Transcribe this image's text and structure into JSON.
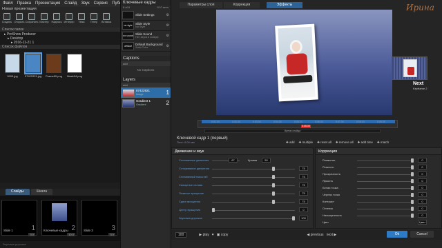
{
  "menubar": {
    "items": [
      "Файл",
      "Правка",
      "Презентация",
      "Слайд",
      "Звук",
      "Сервис",
      "Публикация",
      "Вид"
    ],
    "right": [
      "⌂",
      "?",
      "–",
      "□",
      "×"
    ]
  },
  "project": {
    "title": "Новая презентация"
  },
  "toolbar": {
    "buttons": [
      "Создать",
      "Открыть",
      "Сохранить",
      "Мастер",
      "Надпись",
      "Интерпр",
      "Тема",
      "Генер",
      "Вставка"
    ]
  },
  "folders": {
    "header": "Список папок",
    "tree": [
      "ProShow Producer",
      "Desktop",
      "2016-11-21 1"
    ]
  },
  "files": {
    "header": "Список файлов",
    "items": [
      {
        "name": "9909.jpg",
        "color": "#c7d8e8"
      },
      {
        "name": "07422921.jpg",
        "color": "#4a86c4"
      },
      {
        "name": "Frame89.png",
        "color": "#6b3b1b"
      },
      {
        "name": "Mask94.png",
        "color": "#ffffff"
      }
    ]
  },
  "bottom_tabs": [
    "Слайды",
    "Шкала"
  ],
  "slides": [
    {
      "label": "Slide 1",
      "num": "1",
      "time": "3.0"
    },
    {
      "label": "Ключевые кадры",
      "num": "2",
      "time": "10.0"
    },
    {
      "label": "Slide 3",
      "num": "3",
      "time": "3.0"
    }
  ],
  "status_text": "Звуковая дорожка",
  "keyframes": {
    "title": "Ключевые кадры",
    "sub": "8 of 8",
    "time": "10.0 secs",
    "items": [
      {
        "icon": "",
        "title": "Slide Settings",
        "sub": ""
      },
      {
        "icon": "no style",
        "title": "Slide Style",
        "sub": "No Style"
      },
      {
        "icon": "no sound",
        "title": "Slide Sound",
        "sub": "Нет звука в слайде"
      },
      {
        "icon": "default",
        "title": "Default Background",
        "sub": "Solid Color"
      }
    ]
  },
  "captions": {
    "title": "Captions",
    "add": "add",
    "empty": "No Captions"
  },
  "layers": {
    "title": "Layers",
    "add": "add",
    "items": [
      {
        "name": "07422921",
        "sub": "Image",
        "num": "1",
        "selected": true
      },
      {
        "name": "Gradient 1",
        "sub": "Gradient",
        "num": "2",
        "selected": false
      }
    ]
  },
  "main_tabs": [
    "Параметры слоя",
    "Коррекция",
    "Эффекты"
  ],
  "active_tab": 2,
  "watermark": "Ирина",
  "next": {
    "label": "Next",
    "sub": "Keyframe 2"
  },
  "timeline": {
    "ticks": [
      "0:01.00",
      "0:02.00",
      "0:03.00",
      "0:04.00",
      "0:05.00",
      "0:06.00",
      "0:07.00",
      "0:08.00",
      "0:09.00"
    ],
    "current": "0:05.00",
    "bar_label": "Время слайда"
  },
  "kf_desc": {
    "title": "Ключевой кадр 1 (первый)",
    "time": "Time: 0.00 sec"
  },
  "kf_buttons": [
    "add",
    "multiple",
    "reset all",
    "remove all",
    "add time",
    "match"
  ],
  "motion": {
    "title": "Движение и звук",
    "rows": [
      {
        "label": "Сплаваемые движения",
        "val": "67",
        "extra": "Кривая",
        "extra_val": "50"
      },
      {
        "label": "Сглаживание движения",
        "val": "75"
      },
      {
        "label": "Сплаваемый масштаб",
        "val": "75"
      },
      {
        "label": "Смещение сплава",
        "val": "75"
      },
      {
        "label": "Плавное вращение",
        "val": "75"
      },
      {
        "label": "Сдвиг вращения",
        "val": "75"
      },
      {
        "label": "Центр вращения",
        "val": "0"
      },
      {
        "label": "Звуковая дорожка",
        "val": "100"
      }
    ]
  },
  "correction": {
    "title": "Коррекция",
    "rows": [
      {
        "label": "Размытие",
        "val": "0"
      },
      {
        "label": "Резкость",
        "val": "0"
      },
      {
        "label": "Прозрачность",
        "val": "0"
      },
      {
        "label": "Яркость",
        "val": "0"
      },
      {
        "label": "Белая точка",
        "val": "0"
      },
      {
        "label": "Черная точка",
        "val": "0"
      },
      {
        "label": "Контраст",
        "val": "0"
      },
      {
        "label": "Оттенок",
        "val": "0"
      },
      {
        "label": "Насыщенность",
        "val": "0"
      },
      {
        "label": "Цвет",
        "val": "Цвет"
      }
    ]
  },
  "bottom": {
    "zoom": "100",
    "play": "play",
    "copy": "copy",
    "prev": "previous",
    "next": "next",
    "ok": "Ok",
    "cancel": "Cancel"
  }
}
